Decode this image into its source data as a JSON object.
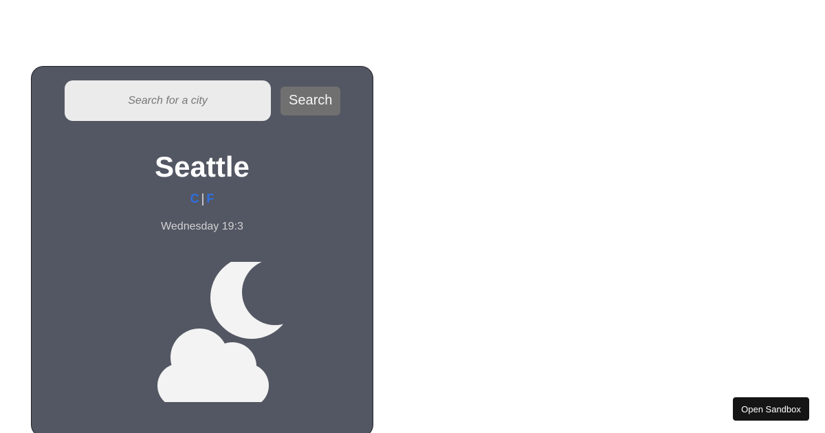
{
  "search": {
    "placeholder": "Search for a city",
    "value": "",
    "button_label": "Search"
  },
  "weather": {
    "city": "Seattle",
    "unit_celsius": "C",
    "unit_separator": "|",
    "unit_fahrenheit": "F",
    "datetime": "Wednesday 19:3",
    "icon": "cloud-rain-moon-icon"
  },
  "sandbox": {
    "button_label": "Open Sandbox"
  },
  "colors": {
    "card_background": "#535763",
    "unit_link": "#2f6fe0",
    "icon_fill": "#f3f3f3"
  }
}
